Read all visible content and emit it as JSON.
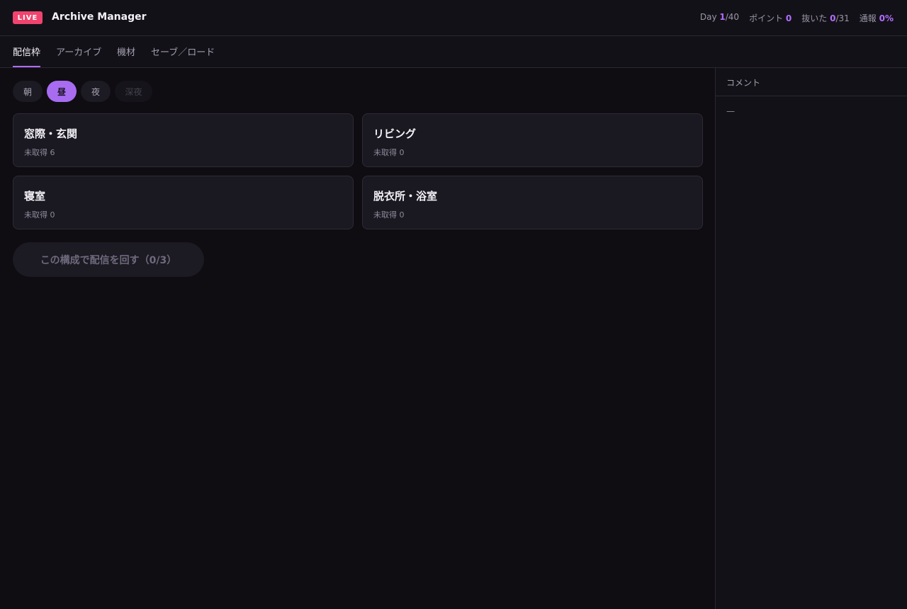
{
  "header": {
    "live_label": "LIVE",
    "app_title": "Archive Manager",
    "stats": {
      "day_label": "Day",
      "day_current": "1",
      "day_total": "/40",
      "points_label": "ポイント",
      "points_value": "0",
      "pulled_label": "抜いた",
      "pulled_current": "0",
      "pulled_total": "/31",
      "report_label": "通報",
      "report_value": "0%"
    }
  },
  "tabs": [
    "配信枠",
    "アーカイブ",
    "機材",
    "セーブ／ロード"
  ],
  "active_tab": "配信枠",
  "time_slots": [
    {
      "label": "朝",
      "state": "normal"
    },
    {
      "label": "昼",
      "state": "active"
    },
    {
      "label": "夜",
      "state": "normal"
    },
    {
      "label": "深夜",
      "state": "disabled"
    }
  ],
  "rooms": [
    {
      "name": "窓際・玄関",
      "count": "未取得 6"
    },
    {
      "name": "リビング",
      "count": "未取得 0"
    },
    {
      "name": "寝室",
      "count": "未取得 0"
    },
    {
      "name": "脱衣所・浴室",
      "count": "未取得 0"
    }
  ],
  "stream_button_label": "この構成で配信を回す（0/3）",
  "sidebar": {
    "title": "コメント",
    "content": "—"
  },
  "colors": {
    "accent": "#b06cf5",
    "live_badge": "#f0446f",
    "background": "#0f0d12"
  }
}
